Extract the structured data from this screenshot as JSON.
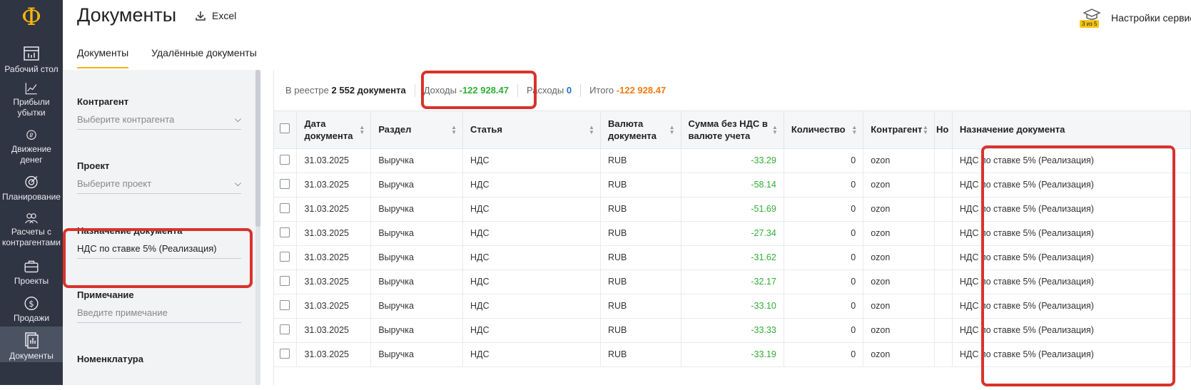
{
  "app": {
    "logo": "Ф"
  },
  "nav": {
    "items": [
      {
        "label1": "Рабочий стол",
        "label2": "",
        "icon": "dashboard-icon"
      },
      {
        "label1": "Прибыли",
        "label2": "убытки",
        "icon": "chart-icon"
      },
      {
        "label1": "Движение",
        "label2": "денег",
        "icon": "money-flow-icon"
      },
      {
        "label1": "Планирование",
        "label2": "",
        "icon": "target-icon"
      },
      {
        "label1": "Расчеты с",
        "label2": "контрагентами",
        "icon": "people-icon"
      },
      {
        "label1": "Проекты",
        "label2": "",
        "icon": "briefcase-icon"
      },
      {
        "label1": "Продажи",
        "label2": "",
        "icon": "dollar-icon"
      },
      {
        "label1": "Документы",
        "label2": "",
        "icon": "documents-icon"
      }
    ]
  },
  "header": {
    "title": "Документы",
    "excel_label": "Excel",
    "settings_label": "Настройки сервиса",
    "settings_badge": "3 из 5"
  },
  "tabs": [
    {
      "label": "Документы",
      "active": true
    },
    {
      "label": "Удалённые документы",
      "active": false
    }
  ],
  "filters": {
    "counterparty": {
      "label": "Контрагент",
      "placeholder": "Выберите контрагента"
    },
    "project": {
      "label": "Проект",
      "placeholder": "Выберите проект"
    },
    "purpose": {
      "label": "Назначение документа",
      "value": "НДС по ставке 5% (Реализация)"
    },
    "note": {
      "label": "Примечание",
      "placeholder": "Введите примечание"
    },
    "nomenclature": {
      "label": "Номенклатура"
    }
  },
  "summary": {
    "registry_prefix": "В реестре",
    "registry_count": "2 552 документа",
    "income_label": "Доходы",
    "income_value": "-122 928.47",
    "expense_label": "Расходы",
    "expense_value": "0",
    "total_label": "Итого",
    "total_value": "-122 928.47"
  },
  "table": {
    "columns": {
      "date1": "Дата",
      "date2": "документа",
      "section": "Раздел",
      "article": "Статья",
      "currency1": "Валюта",
      "currency2": "документа",
      "sum1": "Сумма без НДС в",
      "sum2": "валюте учета",
      "qty": "Количество",
      "counterparty": "Контрагент",
      "number": "Но",
      "purpose": "Назначение документа"
    },
    "rows": [
      {
        "date": "31.03.2025",
        "section": "Выручка",
        "article": "НДС",
        "currency": "RUB",
        "sum": "-33.29",
        "qty": "0",
        "counterparty": "ozon",
        "purpose": "НДС по ставке 5% (Реализация)"
      },
      {
        "date": "31.03.2025",
        "section": "Выручка",
        "article": "НДС",
        "currency": "RUB",
        "sum": "-58.14",
        "qty": "0",
        "counterparty": "ozon",
        "purpose": "НДС по ставке 5% (Реализация)"
      },
      {
        "date": "31.03.2025",
        "section": "Выручка",
        "article": "НДС",
        "currency": "RUB",
        "sum": "-51.69",
        "qty": "0",
        "counterparty": "ozon",
        "purpose": "НДС по ставке 5% (Реализация)"
      },
      {
        "date": "31.03.2025",
        "section": "Выручка",
        "article": "НДС",
        "currency": "RUB",
        "sum": "-27.34",
        "qty": "0",
        "counterparty": "ozon",
        "purpose": "НДС по ставке 5% (Реализация)"
      },
      {
        "date": "31.03.2025",
        "section": "Выручка",
        "article": "НДС",
        "currency": "RUB",
        "sum": "-31.62",
        "qty": "0",
        "counterparty": "ozon",
        "purpose": "НДС по ставке 5% (Реализация)"
      },
      {
        "date": "31.03.2025",
        "section": "Выручка",
        "article": "НДС",
        "currency": "RUB",
        "sum": "-32.17",
        "qty": "0",
        "counterparty": "ozon",
        "purpose": "НДС по ставке 5% (Реализация)"
      },
      {
        "date": "31.03.2025",
        "section": "Выручка",
        "article": "НДС",
        "currency": "RUB",
        "sum": "-33.10",
        "qty": "0",
        "counterparty": "ozon",
        "purpose": "НДС по ставке 5% (Реализация)"
      },
      {
        "date": "31.03.2025",
        "section": "Выручка",
        "article": "НДС",
        "currency": "RUB",
        "sum": "-33.33",
        "qty": "0",
        "counterparty": "ozon",
        "purpose": "НДС по ставке 5% (Реализация)"
      },
      {
        "date": "31.03.2025",
        "section": "Выручка",
        "article": "НДС",
        "currency": "RUB",
        "sum": "-33.19",
        "qty": "0",
        "counterparty": "ozon",
        "purpose": "НДС по ставке 5% (Реализация)"
      }
    ]
  },
  "colors": {
    "accent": "#f5b50b",
    "income": "#2fae33",
    "expense": "#1f6fd1",
    "total": "#f07a12",
    "highlight": "#d9322c",
    "nav_bg": "#2f3542"
  }
}
